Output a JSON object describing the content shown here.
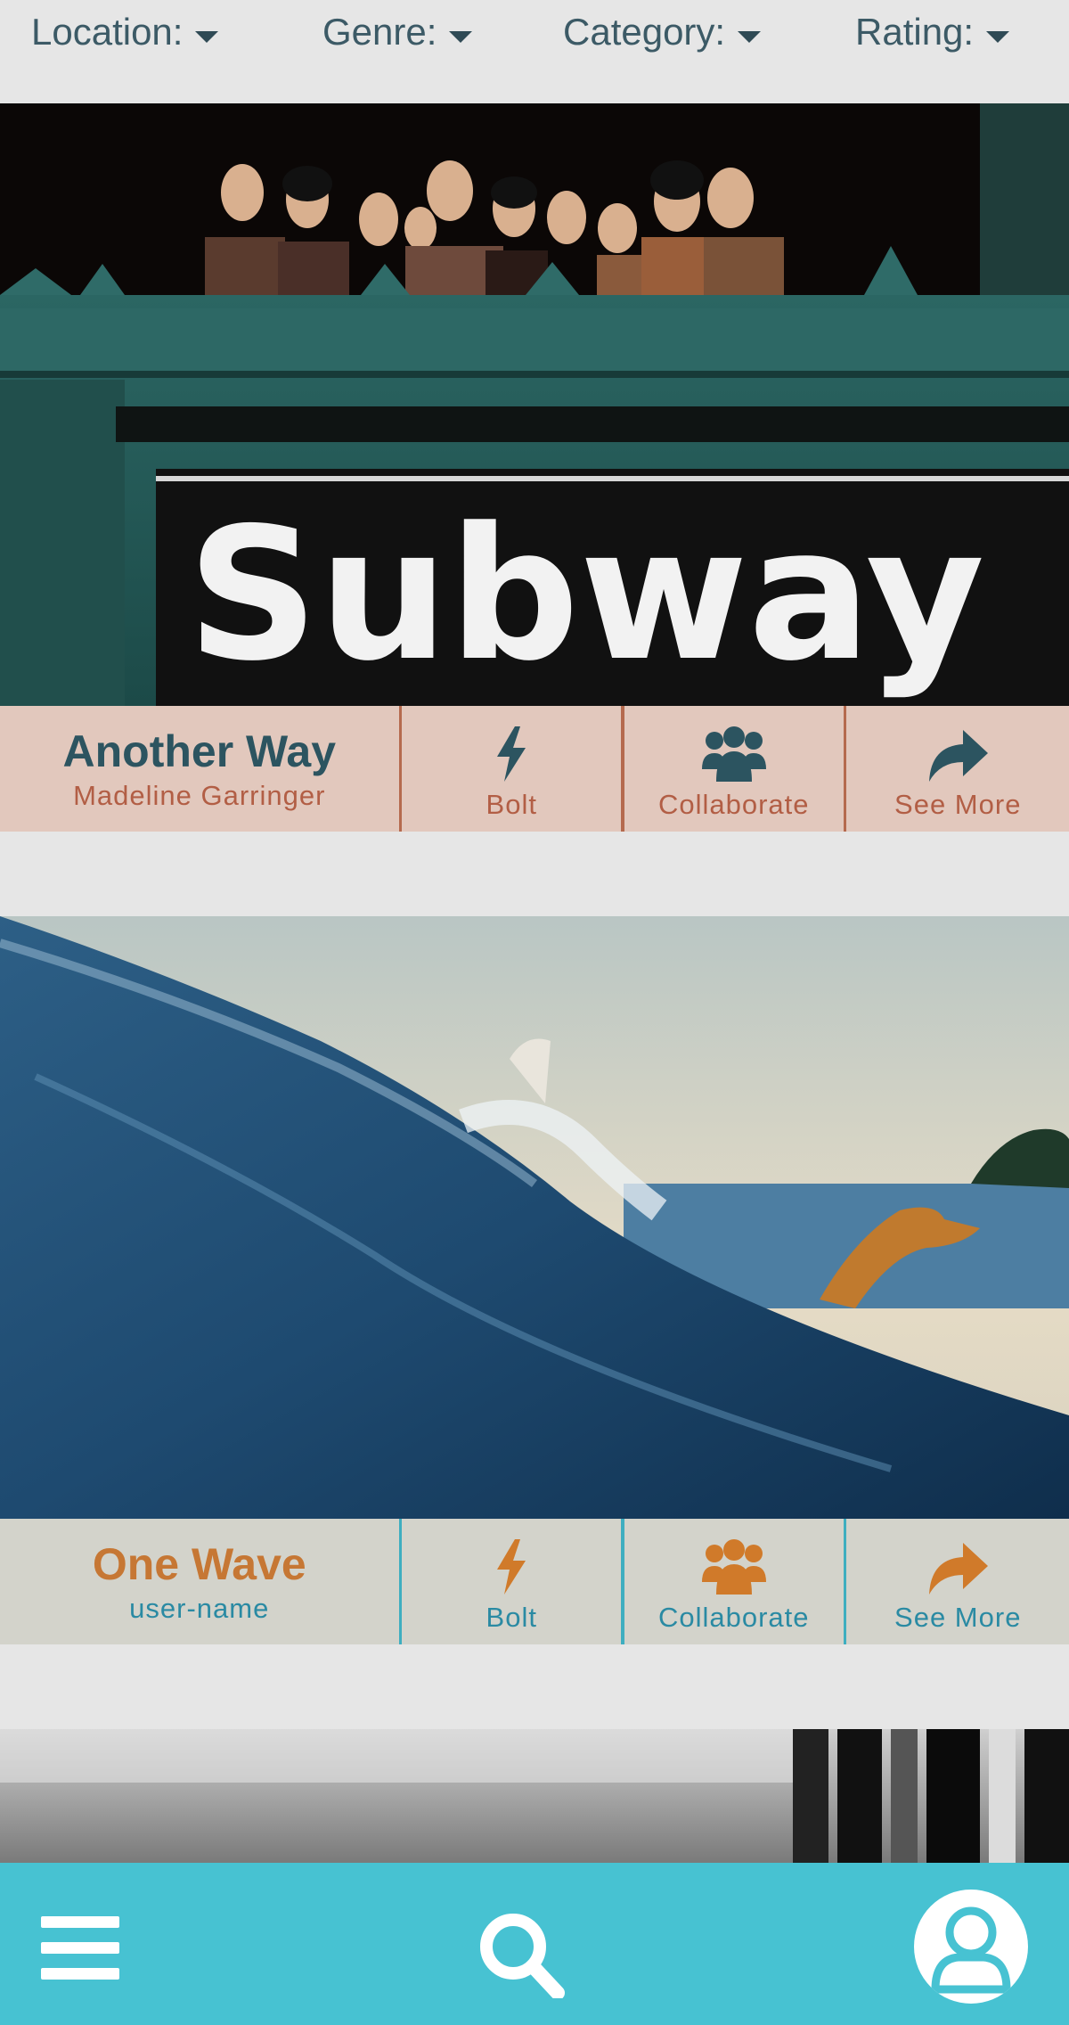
{
  "filters": [
    {
      "label": "Location:"
    },
    {
      "label": "Genre:"
    },
    {
      "label": "Category:"
    },
    {
      "label": "Rating:"
    }
  ],
  "cards": [
    {
      "image_sign_text": "Subway",
      "title": "Another Way",
      "user": "Madeline Garringer",
      "actions": {
        "bolt": "Bolt",
        "collaborate": "Collaborate",
        "see_more": "See More"
      }
    },
    {
      "title": "One Wave",
      "user": "user-name",
      "actions": {
        "bolt": "Bolt",
        "collaborate": "Collaborate",
        "see_more": "See More"
      }
    }
  ],
  "nav": {
    "menu_icon": "hamburger-menu-icon",
    "search_icon": "search-icon",
    "profile_icon": "user-profile-icon",
    "color": "#47c2d2"
  }
}
